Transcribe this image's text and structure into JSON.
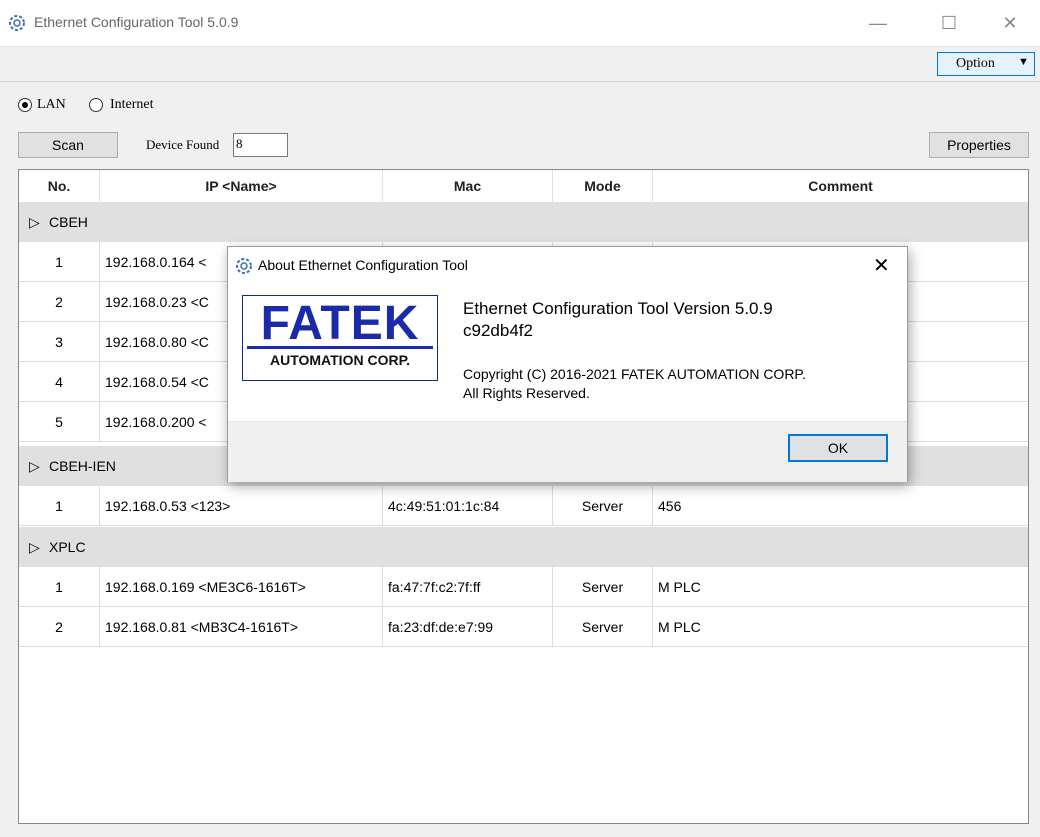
{
  "window": {
    "title": "Ethernet Configuration Tool 5.0.9",
    "minimize": "—",
    "maximize": "☐",
    "close": "✕"
  },
  "toolbar": {
    "option_label": "Option",
    "option_caret": "▼"
  },
  "network": {
    "lan_label": "LAN",
    "internet_label": "Internet",
    "selected": "LAN"
  },
  "actions": {
    "scan_label": "Scan",
    "device_found_label": "Device Found",
    "device_found_value": "8",
    "properties_label": "Properties"
  },
  "table": {
    "columns": [
      "No.",
      "IP <Name>",
      "Mac",
      "Mode",
      "Comment"
    ],
    "groups": [
      {
        "name": "CBEH",
        "rows": [
          {
            "no": "1",
            "ip": "192.168.0.164 <",
            "mac": "",
            "mode": "",
            "comment": ""
          },
          {
            "no": "2",
            "ip": "192.168.0.23 <C",
            "mac": "",
            "mode": "",
            "comment": ""
          },
          {
            "no": "3",
            "ip": "192.168.0.80 <C",
            "mac": "",
            "mode": "",
            "comment": ""
          },
          {
            "no": "4",
            "ip": "192.168.0.54 <C",
            "mac": "",
            "mode": "",
            "comment": ""
          },
          {
            "no": "5",
            "ip": "192.168.0.200 <",
            "mac": "",
            "mode": "",
            "comment": ""
          }
        ]
      },
      {
        "name": "CBEH-IEN",
        "rows": [
          {
            "no": "1",
            "ip": "192.168.0.53 <123>",
            "mac": "4c:49:51:01:1c:84",
            "mode": "Server",
            "comment": "456"
          }
        ]
      },
      {
        "name": "XPLC",
        "rows": [
          {
            "no": "1",
            "ip": "192.168.0.169 <ME3C6-1616T>",
            "mac": "fa:47:7f:c2:7f:ff",
            "mode": "Server",
            "comment": "M PLC"
          },
          {
            "no": "2",
            "ip": "192.168.0.81 <MB3C4-1616T>",
            "mac": "fa:23:df:de:e7:99",
            "mode": "Server",
            "comment": "M PLC"
          }
        ]
      }
    ]
  },
  "dialog": {
    "title": "About Ethernet Configuration Tool",
    "close": "✕",
    "logo_main": "FATEK",
    "logo_sub": "AUTOMATION CORP.",
    "heading": "Ethernet Configuration Tool Version 5.0.9",
    "hash": "c92db4f2",
    "copyright": "Copyright (C) 2016-2021 FATEK AUTOMATION CORP.",
    "rights": "All Rights Reserved.",
    "ok_label": "OK"
  },
  "colors": {
    "accent": "#0078d7",
    "logo_blue": "#1a2aa8",
    "group_bg": "#e0e0e0"
  },
  "icons": {
    "app": "gear-icon"
  }
}
